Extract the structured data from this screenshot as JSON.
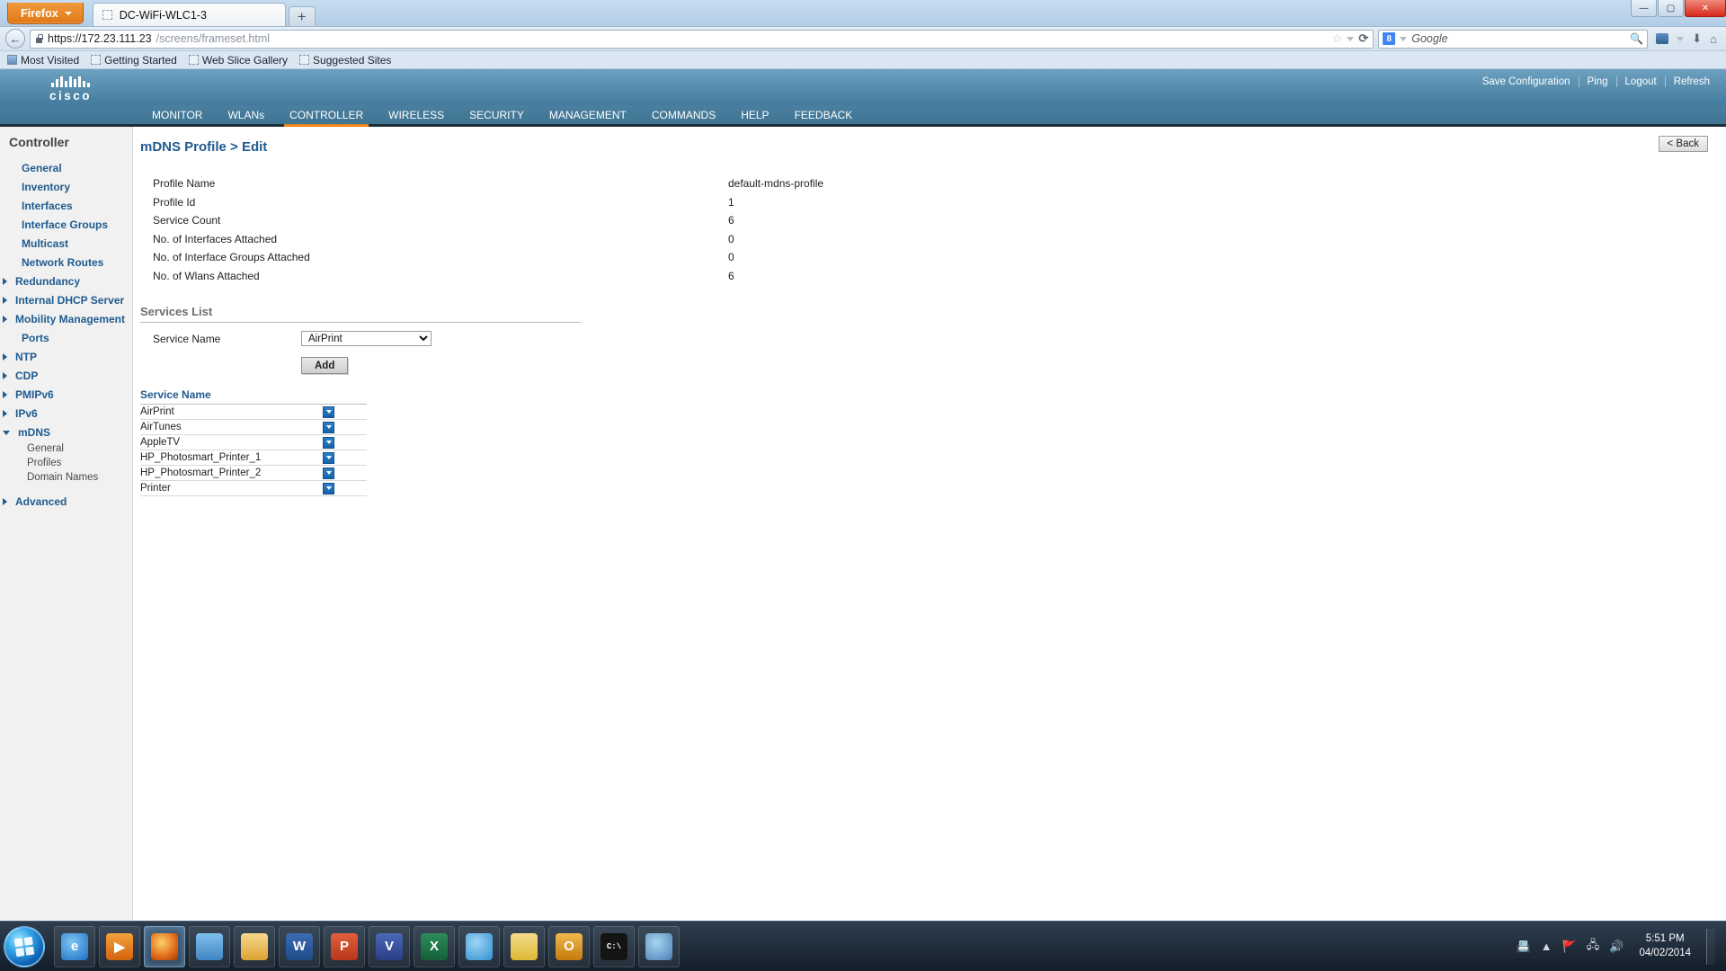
{
  "browser": {
    "app_button": "Firefox",
    "tab_title": "DC-WiFi-WLC1-3",
    "new_tab_label": "+",
    "window_controls": {
      "minimize": "—",
      "maximize": "▢",
      "close": "✕"
    },
    "url_host": "https://172.23.111.23",
    "url_path": "/screens/frameset.html",
    "search_engine": "Google",
    "search_placeholder": "Google",
    "bookmarks": [
      {
        "label": "Most Visited",
        "icon": "bookmark-folder-icon"
      },
      {
        "label": "Getting Started",
        "icon": "page-icon"
      },
      {
        "label": "Web Slice Gallery",
        "icon": "page-icon"
      },
      {
        "label": "Suggested Sites",
        "icon": "page-icon"
      }
    ]
  },
  "cisco": {
    "brand": "cisco",
    "top_links": [
      {
        "label": "Save Configuration",
        "accesskey": "a"
      },
      {
        "label": "Ping",
        "accesskey": ""
      },
      {
        "label": "Logout",
        "accesskey": ""
      },
      {
        "label": "Refresh",
        "accesskey": ""
      }
    ],
    "nav": [
      {
        "label": "MONITOR",
        "active": false
      },
      {
        "label": "WLANs",
        "active": false
      },
      {
        "label": "CONTROLLER",
        "active": true
      },
      {
        "label": "WIRELESS",
        "active": false
      },
      {
        "label": "SECURITY",
        "active": false
      },
      {
        "label": "MANAGEMENT",
        "active": false
      },
      {
        "label": "COMMANDS",
        "active": false
      },
      {
        "label": "HELP",
        "active": false
      },
      {
        "label": "FEEDBACK",
        "active": false
      }
    ],
    "accent_color": "#f0861e",
    "header_color": "#4a7f9f",
    "link_color": "#1f5b8f"
  },
  "sidebar": {
    "title": "Controller",
    "items": [
      {
        "label": "General",
        "arrow": "none"
      },
      {
        "label": "Inventory",
        "arrow": "none"
      },
      {
        "label": "Interfaces",
        "arrow": "none"
      },
      {
        "label": "Interface Groups",
        "arrow": "none"
      },
      {
        "label": "Multicast",
        "arrow": "none"
      },
      {
        "label": "Network Routes",
        "arrow": "none"
      },
      {
        "label": "Redundancy",
        "arrow": "right"
      },
      {
        "label": "Internal DHCP Server",
        "arrow": "right"
      },
      {
        "label": "Mobility Management",
        "arrow": "right"
      },
      {
        "label": "Ports",
        "arrow": "none"
      },
      {
        "label": "NTP",
        "arrow": "right"
      },
      {
        "label": "CDP",
        "arrow": "right"
      },
      {
        "label": "PMIPv6",
        "arrow": "right"
      },
      {
        "label": "IPv6",
        "arrow": "right"
      },
      {
        "label": "mDNS",
        "arrow": "down"
      }
    ],
    "mdns_children": [
      "General",
      "Profiles",
      "Domain Names"
    ],
    "advanced": {
      "label": "Advanced",
      "arrow": "right"
    }
  },
  "main": {
    "page_title": "mDNS Profile > Edit",
    "back_button": "< Back",
    "details": [
      {
        "label": "Profile Name",
        "value": "default-mdns-profile"
      },
      {
        "label": "Profile Id",
        "value": "1"
      },
      {
        "label": "Service Count",
        "value": "6"
      },
      {
        "label": "No. of Interfaces Attached",
        "value": "0"
      },
      {
        "label": "No. of Interface Groups Attached",
        "value": "0"
      },
      {
        "label": "No. of Wlans Attached",
        "value": "6"
      }
    ],
    "services_section_title": "Services List",
    "service_name_label": "Service Name",
    "service_select_value": "AirPrint",
    "service_select_options": [
      "AirPrint",
      "AirTunes",
      "AppleTV",
      "HP_Photosmart_Printer_1",
      "HP_Photosmart_Printer_2",
      "Printer"
    ],
    "add_button": "Add",
    "table_header": "Service Name",
    "table_rows": [
      {
        "name": "AirPrint"
      },
      {
        "name": "AirTunes"
      },
      {
        "name": "AppleTV"
      },
      {
        "name": "HP_Photosmart_Printer_1"
      },
      {
        "name": "HP_Photosmart_Printer_2"
      },
      {
        "name": "Printer"
      }
    ]
  },
  "taskbar": {
    "apps": [
      {
        "name": "internet-explorer",
        "glyph": "e",
        "color": "#1a6fc4",
        "active": false
      },
      {
        "name": "media-player",
        "glyph": "▶",
        "color": "#e8741a",
        "active": false
      },
      {
        "name": "firefox",
        "glyph": "🦊",
        "color": "#e06b18",
        "active": true
      },
      {
        "name": "notepad",
        "glyph": "📘",
        "color": "#4f9ad6",
        "active": false
      },
      {
        "name": "file-explorer",
        "glyph": "🗂",
        "color": "#e8b04a",
        "active": false
      },
      {
        "name": "word",
        "glyph": "W",
        "color": "#2b579a",
        "active": false
      },
      {
        "name": "powerpoint",
        "glyph": "P",
        "color": "#d24726",
        "active": false
      },
      {
        "name": "visio",
        "glyph": "V",
        "color": "#3955a3",
        "active": false
      },
      {
        "name": "excel",
        "glyph": "X",
        "color": "#1d7044",
        "active": false
      },
      {
        "name": "web-browser",
        "glyph": "🌐",
        "color": "#2f8fd0",
        "active": false
      },
      {
        "name": "sticky-note",
        "glyph": "📒",
        "color": "#e8c55a",
        "active": false
      },
      {
        "name": "outlook",
        "glyph": "O",
        "color": "#d98b12",
        "active": false
      },
      {
        "name": "command-prompt",
        "glyph": "C:\\",
        "color": "#1a1a1a",
        "active": false
      },
      {
        "name": "remote-desktop",
        "glyph": "🧭",
        "color": "#5a8ec4",
        "active": false
      }
    ],
    "tray_icons": [
      "📇",
      "▲",
      "🚩",
      "🖧",
      "🔊"
    ],
    "clock_time": "5:51 PM",
    "clock_date": "04/02/2014"
  }
}
